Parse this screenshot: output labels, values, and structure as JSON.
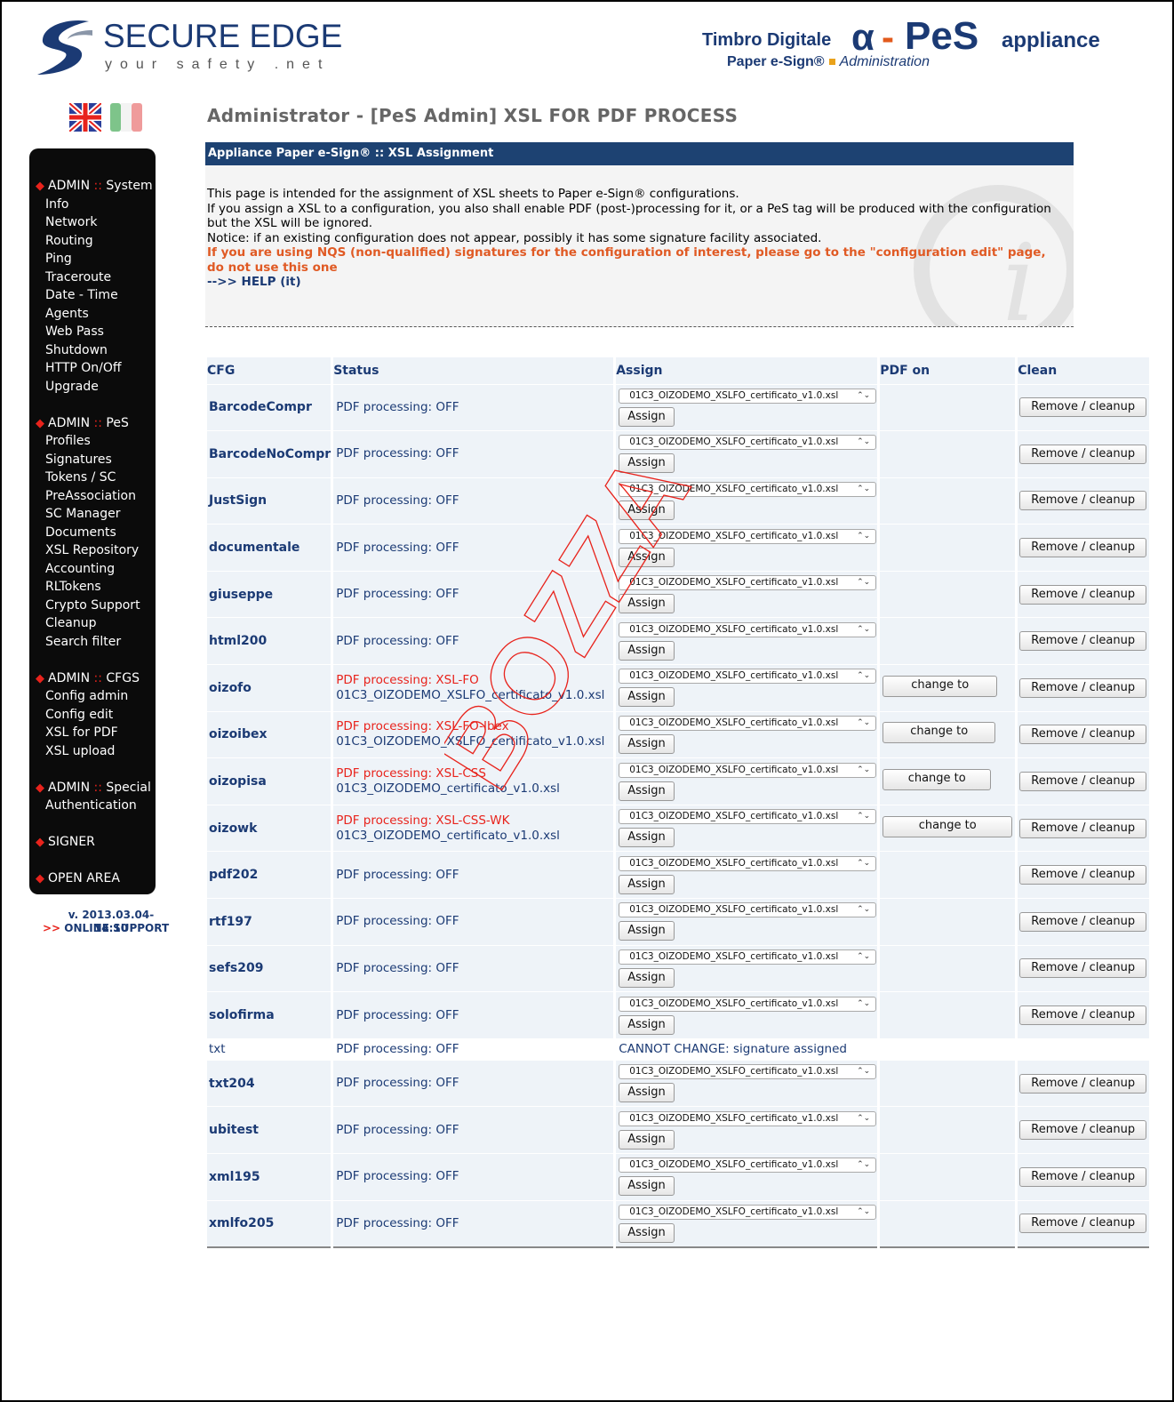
{
  "header": {
    "brand_title": "SECURE EDGE",
    "brand_tagline": "your safety .net",
    "product_timbro": "Timbro Digitale",
    "product_alpha": "α",
    "product_dash": "-",
    "product_pes": "PeS",
    "product_appliance": "appliance",
    "product_paper": "Paper e-Sign®",
    "product_admin": "Administration"
  },
  "flags": {
    "uk": "uk-flag-icon",
    "it": "it-flag-icon"
  },
  "sidebar": {
    "groups": [
      {
        "head": "ADMIN",
        "sep": "::",
        "name": "System",
        "items": [
          "Info",
          "Network",
          "Routing",
          "Ping",
          "Traceroute",
          "Date - Time",
          "Agents",
          "Web Pass",
          "Shutdown",
          "HTTP On/Off",
          "Upgrade"
        ]
      },
      {
        "head": "ADMIN",
        "sep": "::",
        "name": "PeS",
        "items": [
          "Profiles",
          "Signatures",
          "Tokens / SC",
          "PreAssociation",
          "SC Manager",
          "Documents",
          "XSL Repository",
          "Accounting",
          "RLTokens",
          "Crypto Support",
          "Cleanup",
          "Search filter"
        ]
      },
      {
        "head": "ADMIN",
        "sep": "::",
        "name": "CFGS",
        "items": [
          "Config admin",
          "Config edit",
          "XSL for PDF",
          "XSL upload"
        ]
      },
      {
        "head": "ADMIN",
        "sep": "::",
        "name": "Special",
        "items": [
          "Authentication"
        ]
      },
      {
        "head": "SIGNER",
        "sep": "",
        "name": "",
        "items": []
      },
      {
        "head": "OPEN AREA",
        "sep": "",
        "name": "",
        "items": []
      }
    ],
    "version": "v. 2013.03.04-14:10",
    "support_arrow": ">>",
    "support": "ONLINE SUPPORT"
  },
  "main": {
    "page_title": "Administrator - [PeS Admin] XSL FOR PDF PROCESS",
    "section_title": "Appliance Paper e-Sign® :: XSL Assignment",
    "info": {
      "line1": "This page is intended for the assignment of XSL sheets to Paper e-Sign® configurations.",
      "line2": "If you assign a XSL to a configuration, you also shall enable PDF (post-)processing for it, or a PeS tag will be produced with the configuration but the XSL will be ignored.",
      "line3": "Notice: if an existing configuration does not appear, possibly it has some signature facility associated.",
      "warning": "If you are using NQS (non-qualified) signatures for the configuration of interest, please go to the \"configuration edit\" page, do not use this one",
      "help": "-->> HELP (it)"
    },
    "watermark": "BOZZA"
  },
  "table": {
    "headers": {
      "cfg": "CFG",
      "status": "Status",
      "assign": "Assign",
      "pdfon": "PDF on",
      "clean": "Clean"
    },
    "select_value": "01C3_OIZODEMO_XSLFO_certificato_v1.0.xsl",
    "assign_label": "Assign",
    "clean_label": "Remove / cleanup",
    "change_label": "change to",
    "rows": [
      {
        "cfg": "BarcodeCompr",
        "status": "PDF processing: OFF"
      },
      {
        "cfg": "BarcodeNoCompr",
        "status": "PDF processing: OFF"
      },
      {
        "cfg": "JustSign",
        "status": "PDF processing: OFF"
      },
      {
        "cfg": "documentale",
        "status": "PDF processing: OFF"
      },
      {
        "cfg": "giuseppe",
        "status": "PDF processing: OFF"
      },
      {
        "cfg": "html200",
        "status": "PDF processing: OFF"
      },
      {
        "cfg": "oizofo",
        "status_on": "PDF processing: XSL-FO",
        "file": "01C3_OIZODEMO_XSLFO_certificato_v1.0.xsl",
        "change": true
      },
      {
        "cfg": "oizoibex",
        "status_on": "PDF processing: XSL-FO-Ibex",
        "file": "01C3_OIZODEMO_XSLFO_certificato_v1.0.xsl",
        "change": true
      },
      {
        "cfg": "oizopisa",
        "status_on": "PDF processing: XSL-CSS",
        "file": "01C3_OIZODEMO_certificato_v1.0.xsl",
        "change": true
      },
      {
        "cfg": "oizowk",
        "status_on": "PDF processing: XSL-CSS-WK",
        "file": "01C3_OIZODEMO_certificato_v1.0.xsl",
        "change": true
      },
      {
        "cfg": "pdf202",
        "status": "PDF processing: OFF"
      },
      {
        "cfg": "rtf197",
        "status": "PDF processing: OFF"
      },
      {
        "cfg": "sefs209",
        "status": "PDF processing: OFF"
      },
      {
        "cfg": "solofirma",
        "status": "PDF processing: OFF"
      },
      {
        "cfg": "txt",
        "status": "PDF processing: OFF",
        "cannot": "CANNOT CHANGE: signature assigned"
      },
      {
        "cfg": "txt204",
        "status": "PDF processing: OFF"
      },
      {
        "cfg": "ubitest",
        "status": "PDF processing: OFF"
      },
      {
        "cfg": "xml195",
        "status": "PDF processing: OFF"
      },
      {
        "cfg": "xmlfo205",
        "status": "PDF processing: OFF"
      }
    ]
  },
  "colors": {
    "navy": "#1d4272",
    "accent_red": "#e8231c",
    "warning": "#e05a24",
    "row_bg": "#eef3f8"
  }
}
